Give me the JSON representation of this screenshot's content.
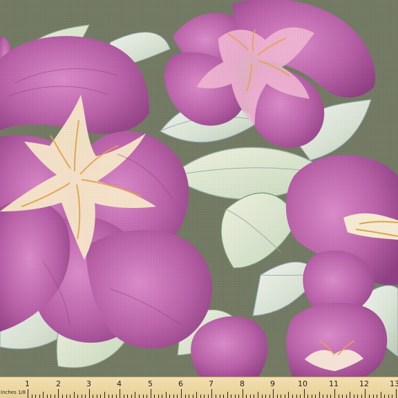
{
  "ruler": {
    "unit_label": "Inches 1/8",
    "numbers": [
      "1",
      "2",
      "3",
      "4",
      "5",
      "6",
      "7",
      "8",
      "9",
      "10",
      "11",
      "12",
      "13"
    ]
  }
}
